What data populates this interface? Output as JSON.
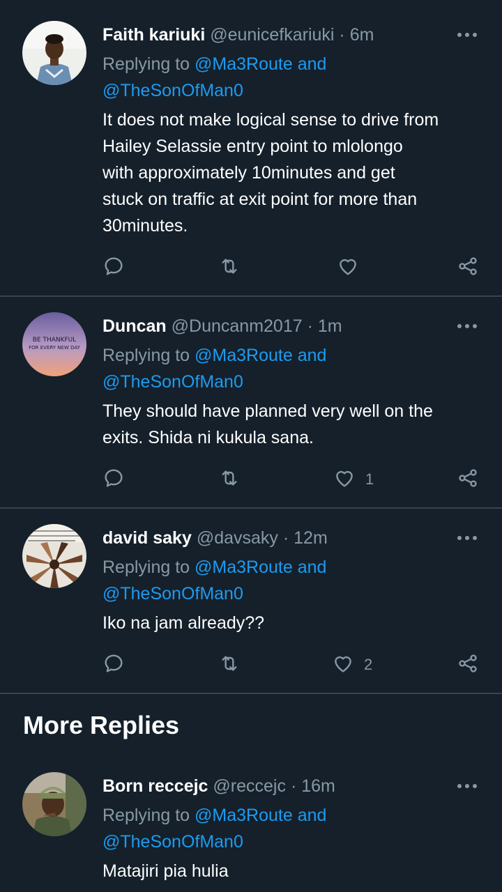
{
  "tweets": [
    {
      "name": "Faith kariuki",
      "handle": "@eunicefkariuki",
      "sep": "·",
      "time": "6m",
      "replying_prefix": "Replying to",
      "mention1": "@Ma3Route and",
      "mention2": "@TheSonOfMan0",
      "lines": [
        "It does not make logical sense to drive from",
        "Hailey Selassie entry point to mlolongo",
        "with approximately 10minutes and get",
        "stuck on traffic at exit point for more than",
        "30minutes."
      ],
      "likes": ""
    },
    {
      "name": "Duncan",
      "handle": "@Duncanm2017",
      "sep": "·",
      "time": "1m",
      "replying_prefix": "Replying to",
      "mention1": "@Ma3Route and",
      "mention2": "@TheSonOfMan0",
      "lines": [
        "They should have planned very well on the",
        "exits. Shida ni kukula sana."
      ],
      "likes": "1",
      "avatar_text": [
        "BE THANKFUL",
        "FOR EVERY NEW DAY"
      ]
    },
    {
      "name": "david saky",
      "handle": "@davsaky",
      "sep": "·",
      "time": "12m",
      "replying_prefix": "Replying to",
      "mention1": "@Ma3Route and",
      "mention2": "@TheSonOfMan0",
      "lines": [
        "Iko na jam already??"
      ],
      "likes": "2"
    },
    {
      "name": "Born reccejc",
      "handle": "@reccejc",
      "sep": "·",
      "time": "16m",
      "replying_prefix": "Replying to",
      "mention1": "@Ma3Route and",
      "mention2": "@TheSonOfMan0",
      "lines": [
        "Matajiri pia hulia"
      ]
    }
  ],
  "more_replies_title": "More Replies",
  "icons": [
    "reply-icon",
    "retweet-icon",
    "like-icon",
    "share-icon",
    "more-options-icon"
  ],
  "colors": {
    "background": "#15202b",
    "mention": "#1d9bf0",
    "muted": "#8899a6",
    "divider": "#38444d"
  }
}
